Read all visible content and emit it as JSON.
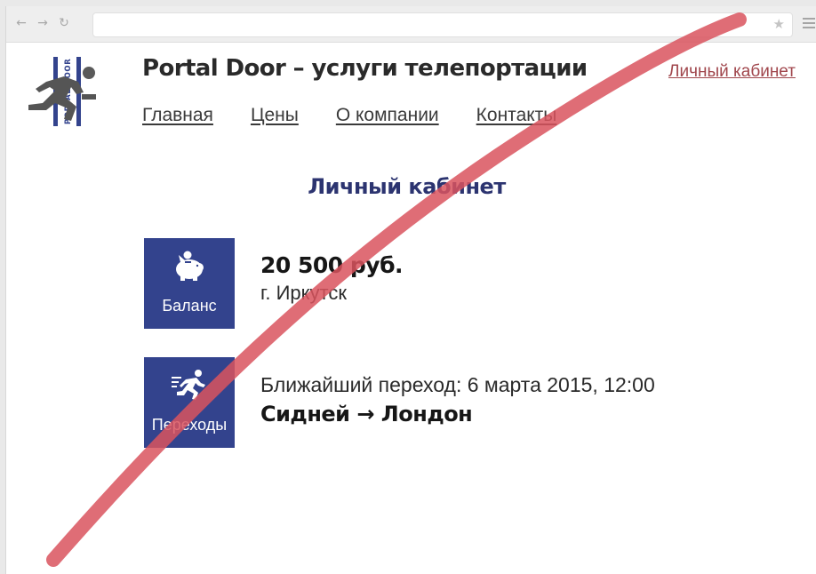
{
  "browser": {
    "back_icon": "arrow-left-icon",
    "forward_icon": "arrow-right-icon",
    "reload_icon": "reload-icon",
    "bookmark_icon": "star-icon",
    "menu_icon": "hamburger-menu-icon",
    "address": ""
  },
  "header": {
    "logo_text": "PORTAL DOOR",
    "title": "Portal Door – услуги телепортации",
    "account_link": "Личный кабинет",
    "nav": [
      {
        "label": "Главная"
      },
      {
        "label": "Цены"
      },
      {
        "label": "О компании"
      },
      {
        "label": "Контакты"
      }
    ]
  },
  "page": {
    "heading": "Личный кабинет",
    "balance": {
      "tile_label": "Баланс",
      "icon": "piggy-bank-icon",
      "amount": "20 500 руб.",
      "city": "г. Иркутск"
    },
    "trips": {
      "tile_label": "Переходы",
      "icon": "running-man-icon",
      "next_trip": "Ближайший переход: 6 марта 2015, 12:00",
      "route": "Сидней → Лондон"
    }
  },
  "colors": {
    "accent": "#33438d",
    "heading": "#2c3470",
    "link": "#a0464c",
    "strike": "#d9545e"
  }
}
